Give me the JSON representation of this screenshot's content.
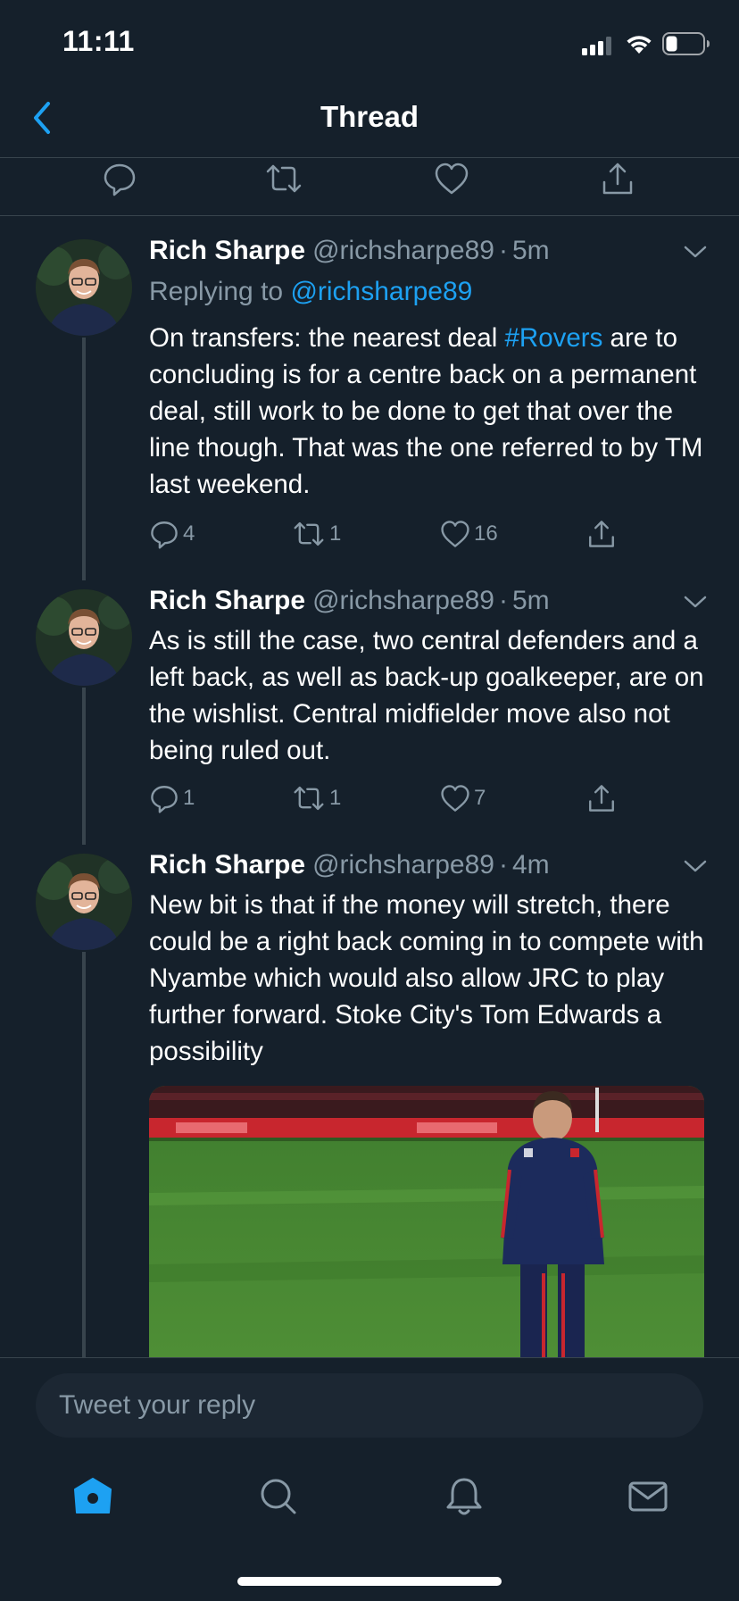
{
  "status_bar": {
    "time": "11:11"
  },
  "nav": {
    "title": "Thread"
  },
  "tweets": [
    {
      "name": "Rich Sharpe",
      "handle": "@richsharpe89",
      "sep": "·",
      "time": "5m",
      "replying_prefix": "Replying to",
      "replying_handle": "@richsharpe89",
      "text_before": "On transfers: the nearest deal",
      "hashtag": "#Rovers",
      "text_after": "are to concluding is for a centre back on a permanent deal, still work to be done to get that over the line though. That was the one referred to by TM last weekend.",
      "replies": "4",
      "retweets": "1",
      "likes": "16"
    },
    {
      "name": "Rich Sharpe",
      "handle": "@richsharpe89",
      "sep": "·",
      "time": "5m",
      "text": "As is still the case, two central defenders and a left back, as well as back-up goalkeeper, are on the wishlist. Central midfielder move also not being ruled out.",
      "replies": "1",
      "retweets": "1",
      "likes": "7"
    },
    {
      "name": "Rich Sharpe",
      "handle": "@richsharpe89",
      "sep": "·",
      "time": "4m",
      "text": "New bit is that if the money will stretch, there could be a right back coming in to compete with Nyambe which would also allow JRC to play further forward. Stoke City's Tom Edwards a possibility"
    }
  ],
  "reply_box": {
    "placeholder": "Tweet your reply"
  },
  "colors": {
    "background": "#15202b",
    "accent": "#1da1f2",
    "secondary_text": "#8899a6",
    "divider": "#38444d"
  },
  "icons": {
    "top_actions": [
      "reply-icon",
      "retweet-icon",
      "like-icon",
      "share-icon"
    ],
    "tabs": [
      "home-icon",
      "search-icon",
      "notifications-icon",
      "messages-icon"
    ]
  }
}
